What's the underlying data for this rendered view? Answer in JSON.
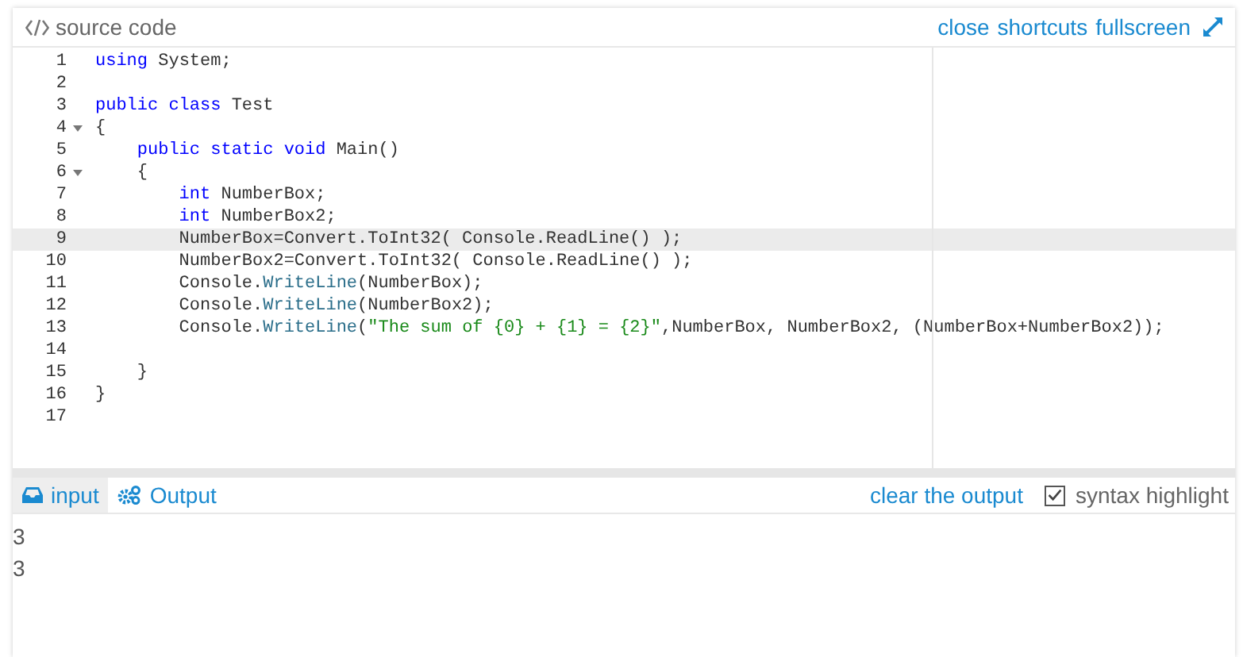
{
  "header": {
    "title": "source code",
    "links": [
      "close",
      "shortcuts",
      "fullscreen"
    ]
  },
  "editor": {
    "lines": [
      {
        "number": "1",
        "fold": false,
        "active": false,
        "tokens": [
          {
            "kind": "keyword",
            "text": "using"
          },
          {
            "kind": "plain",
            "text": " System;"
          }
        ]
      },
      {
        "number": "2",
        "fold": false,
        "active": false
      },
      {
        "number": "3",
        "fold": false,
        "active": false,
        "tokens": [
          {
            "kind": "keyword",
            "text": "public class"
          },
          {
            "kind": "plain",
            "text": " Test"
          }
        ]
      },
      {
        "number": "4",
        "fold": true,
        "active": false,
        "tokens": [
          {
            "kind": "plain",
            "text": "{"
          }
        ]
      },
      {
        "number": "5",
        "fold": false,
        "active": false,
        "tokens": [
          {
            "kind": "keyword",
            "text": "    public static void"
          },
          {
            "kind": "plain",
            "text": " Main()"
          }
        ]
      },
      {
        "number": "6",
        "fold": true,
        "active": false,
        "tokens": [
          {
            "kind": "plain",
            "text": "    {"
          }
        ]
      },
      {
        "number": "7",
        "fold": false,
        "active": false,
        "tokens": [
          {
            "kind": "keyword",
            "text": "        int"
          },
          {
            "kind": "plain",
            "text": " NumberBox;"
          }
        ]
      },
      {
        "number": "8",
        "fold": false,
        "active": false,
        "tokens": [
          {
            "kind": "keyword",
            "text": "        int"
          },
          {
            "kind": "plain",
            "text": " NumberBox2;"
          }
        ]
      },
      {
        "number": "9",
        "fold": false,
        "active": true,
        "tokens": [
          {
            "kind": "plain",
            "text": "        NumberBox=Convert.ToInt32( Console.ReadLine() );"
          }
        ]
      },
      {
        "number": "10",
        "fold": false,
        "active": false,
        "tokens": [
          {
            "kind": "plain",
            "text": "        NumberBox2=Convert.ToInt32( Console.ReadLine() );"
          }
        ]
      },
      {
        "number": "11",
        "fold": false,
        "active": false,
        "tokens": [
          {
            "kind": "plain",
            "text": "        Console."
          },
          {
            "kind": "method",
            "text": "WriteLine"
          },
          {
            "kind": "plain",
            "text": "(NumberBox);"
          }
        ]
      },
      {
        "number": "12",
        "fold": false,
        "active": false,
        "tokens": [
          {
            "kind": "plain",
            "text": "        Console."
          },
          {
            "kind": "method",
            "text": "WriteLine"
          },
          {
            "kind": "plain",
            "text": "(NumberBox2);"
          }
        ]
      },
      {
        "number": "13",
        "fold": false,
        "active": false,
        "tokens": [
          {
            "kind": "plain",
            "text": "        Console."
          },
          {
            "kind": "method",
            "text": "WriteLine"
          },
          {
            "kind": "plain",
            "text": "("
          },
          {
            "kind": "string",
            "text": "\"The sum of {0} + {1} = {2}\""
          },
          {
            "kind": "plain",
            "text": ",NumberBox, NumberBox2, (NumberBox+NumberBox2));"
          }
        ]
      },
      {
        "number": "14",
        "fold": false,
        "active": false
      },
      {
        "number": "15",
        "fold": false,
        "active": false,
        "tokens": [
          {
            "kind": "plain",
            "text": "    }"
          }
        ]
      },
      {
        "number": "16",
        "fold": false,
        "active": false,
        "tokens": [
          {
            "kind": "plain",
            "text": "}"
          }
        ]
      },
      {
        "number": "17",
        "fold": false,
        "active": false
      }
    ]
  },
  "io": {
    "tabs": [
      {
        "label": "input",
        "kind": "input",
        "selected": true
      },
      {
        "label": "Output",
        "kind": "output",
        "selected": false
      }
    ],
    "clear": "clear the output",
    "syntax_highlight": {
      "label": "syntax highlight",
      "checked": true
    },
    "lines": [
      "3",
      "3"
    ]
  }
}
